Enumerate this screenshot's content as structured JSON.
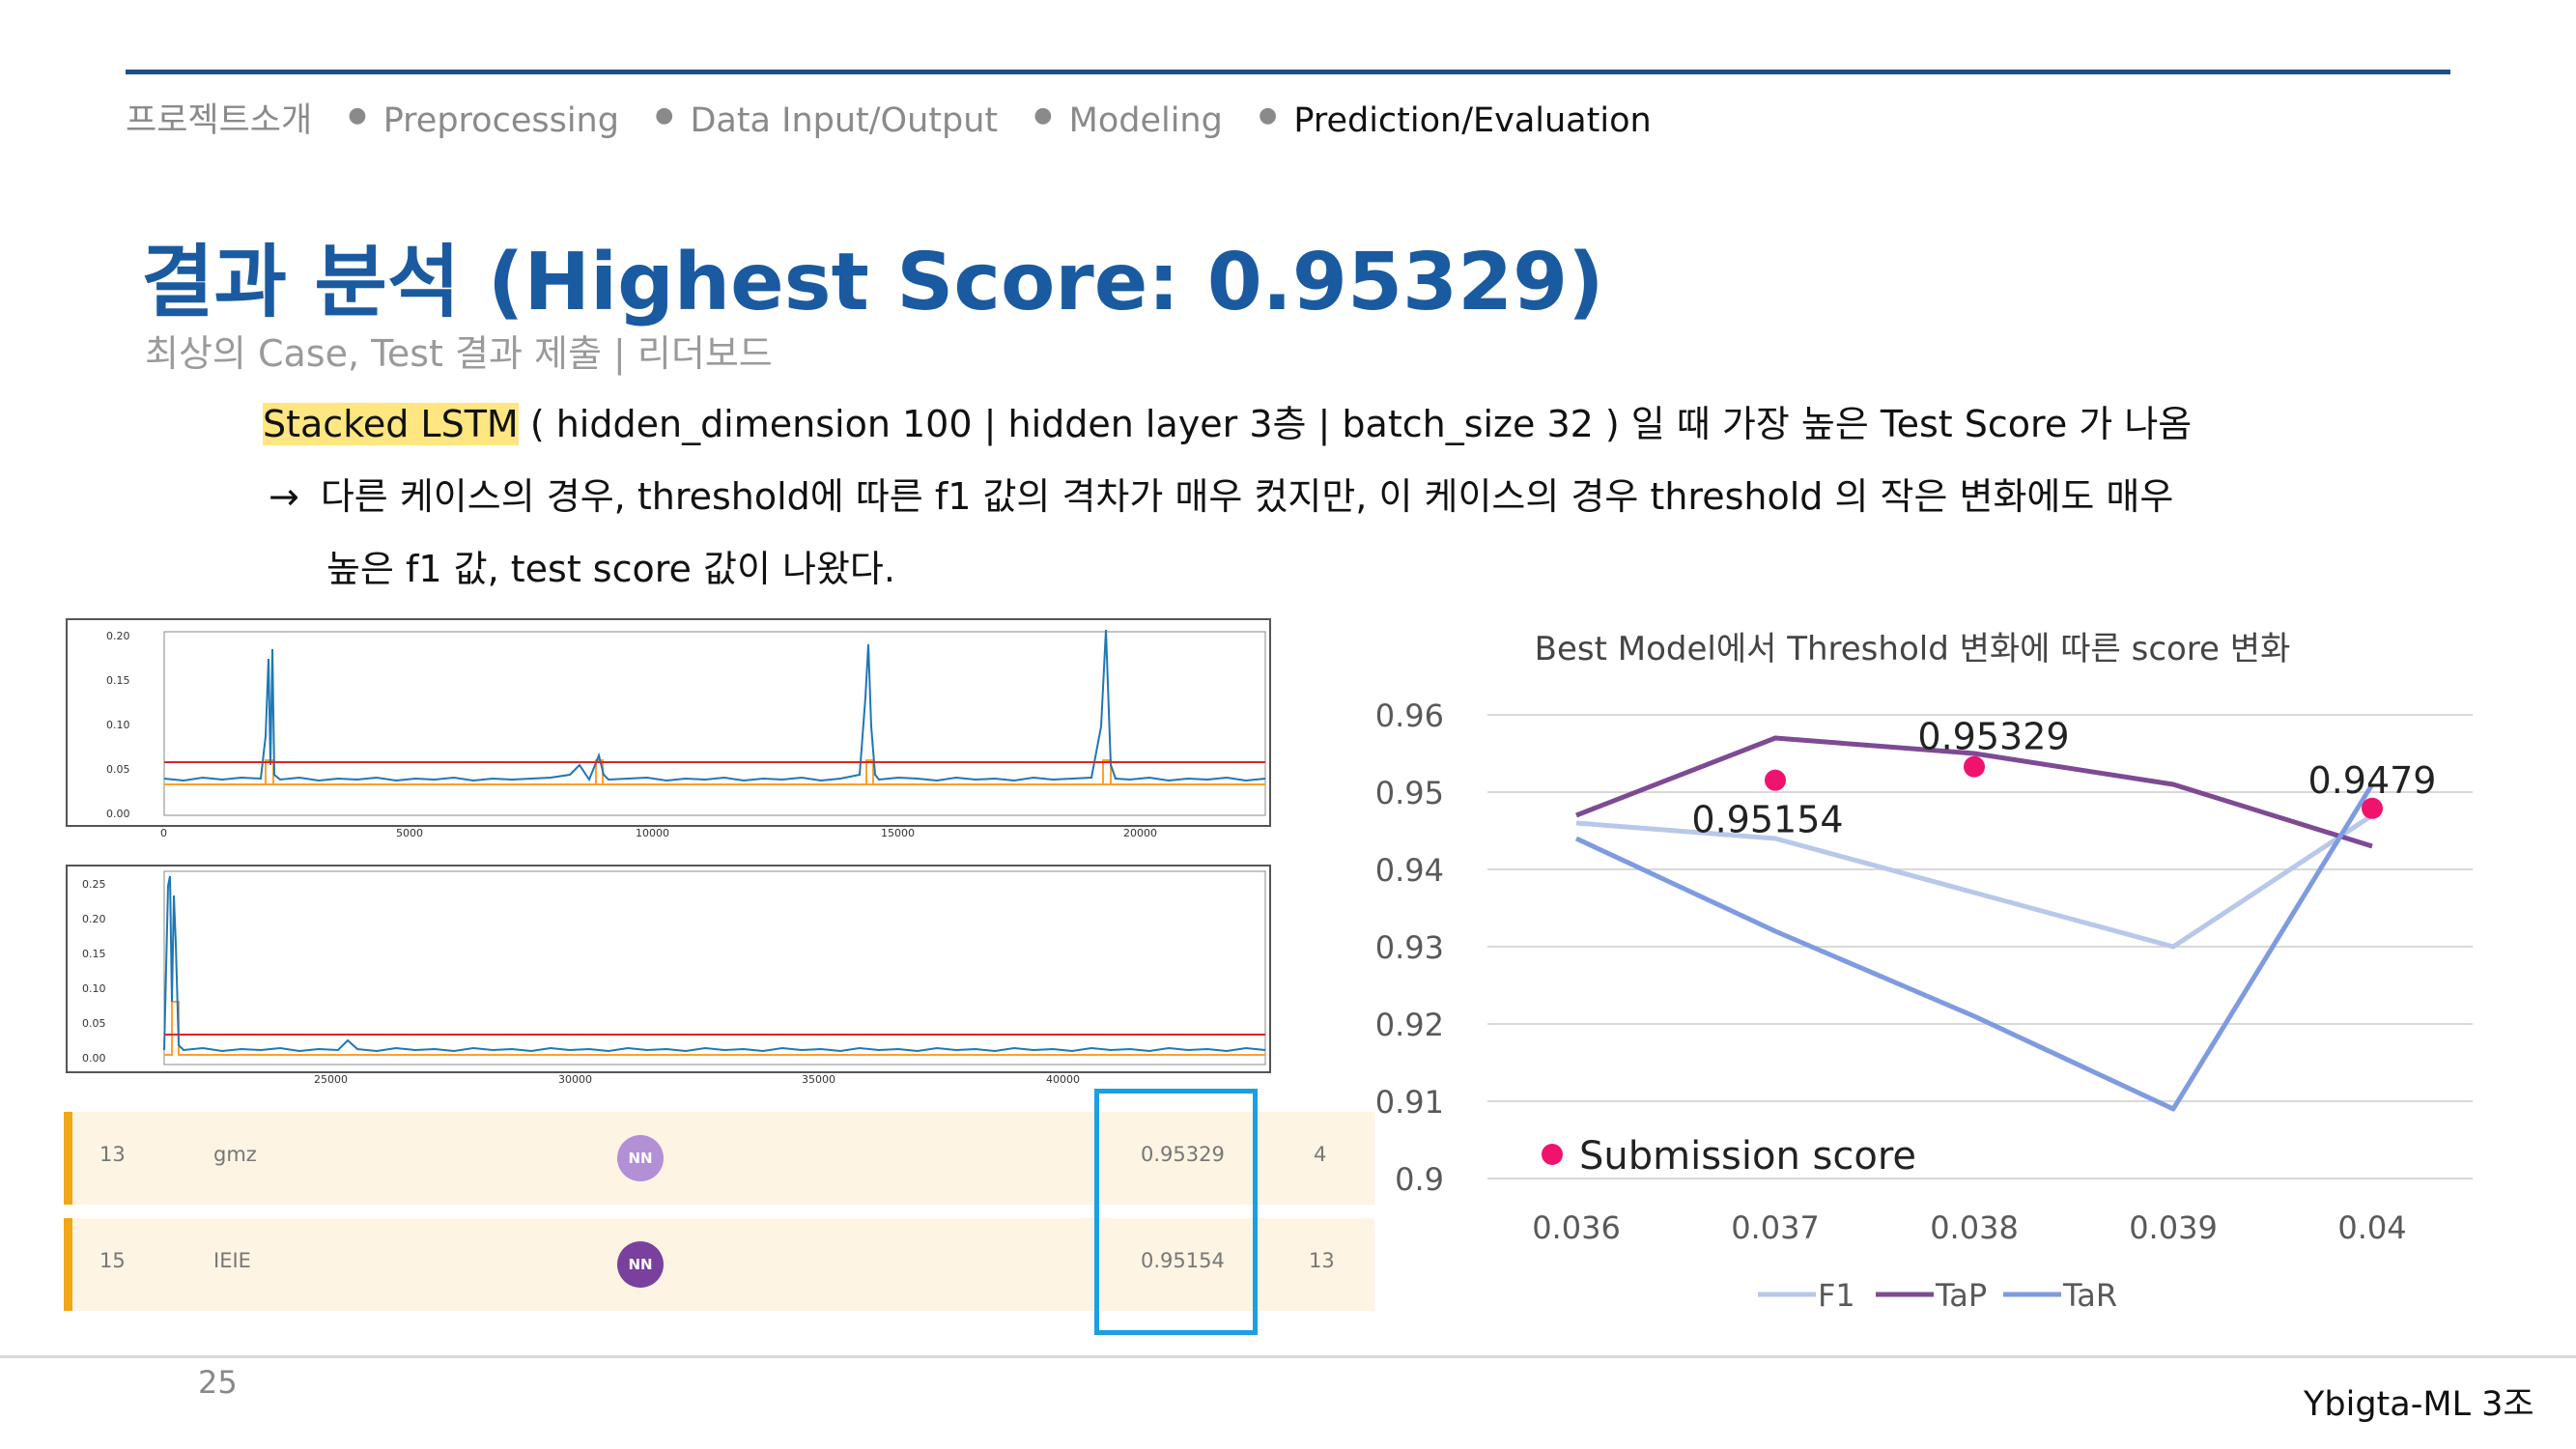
{
  "nav": {
    "items": [
      "프로젝트소개",
      "Preprocessing",
      "Data Input/Output",
      "Modeling",
      "Prediction/Evaluation"
    ],
    "active": "Prediction/Evaluation"
  },
  "title": "결과 분석 (Highest Score: 0.95329)",
  "subtitle": "최상의 Case, Test 결과 제출 | 리더보드",
  "body": {
    "highlight": "Stacked LSTM",
    "line1_rest": " ( hidden_dimension 100 | hidden layer 3층 | batch_size 32 ) 일 때 가장 높은 Test Score 가 나옴",
    "arrow": "→",
    "line2": "다른 케이스의 경우, threshold에 따른 f1 값의 격차가 매우 컸지만, 이 케이스의 경우 threshold 의 작은 변화에도 매우",
    "line3": "높은 f1 값, test score 값이 나왔다."
  },
  "plot1": {
    "yticks": [
      "0.20",
      "0.15",
      "0.10",
      "0.05",
      "0.00"
    ],
    "xticks": [
      "0",
      "5000",
      "10000",
      "15000",
      "20000"
    ],
    "colors": {
      "signal": "#1f77b4",
      "label": "#ff9f2e",
      "threshold": "#d62728"
    }
  },
  "plot2": {
    "yticks": [
      "0.25",
      "0.20",
      "0.15",
      "0.10",
      "0.05",
      "0.00"
    ],
    "xticks": [
      "25000",
      "30000",
      "35000",
      "40000"
    ]
  },
  "leaderboard": [
    {
      "rank": "13",
      "team": "gmz",
      "badge": "NN",
      "badge_color": "#b38fd6",
      "score": "0.95329",
      "entries": "4"
    },
    {
      "rank": "15",
      "team": "IEIE",
      "badge": "NN",
      "badge_color": "#7b3f9e",
      "score": "0.95154",
      "entries": "13"
    }
  ],
  "footer": {
    "page": "25",
    "team": "Ybigta-ML 3조"
  },
  "chart_data": {
    "type": "line",
    "title": "Best Model에서 Threshold 변화에 따른 score 변화",
    "x": [
      0.036,
      0.037,
      0.038,
      0.039,
      0.04
    ],
    "xticks": [
      "0.036",
      "0.037",
      "0.038",
      "0.039",
      "0.04"
    ],
    "ylim": [
      0.9,
      0.96
    ],
    "yticks": [
      "0.96",
      "0.95",
      "0.94",
      "0.93",
      "0.92",
      "0.91",
      "0.9"
    ],
    "grid": true,
    "legend_position": "bottom",
    "series": [
      {
        "name": "F1",
        "color": "#b8c8ea",
        "values": [
          0.946,
          0.944,
          0.937,
          0.93,
          0.947
        ]
      },
      {
        "name": "TaP",
        "color": "#7e4a94",
        "values": [
          0.947,
          0.957,
          0.955,
          0.951,
          0.943
        ]
      },
      {
        "name": "TaR",
        "color": "#7f9be0",
        "values": [
          0.944,
          0.932,
          0.921,
          0.909,
          0.951
        ]
      }
    ],
    "submission": {
      "name": "Submission score",
      "color": "#f0136e",
      "points": [
        {
          "x": 0.037,
          "y": 0.95154,
          "label": "0.95154"
        },
        {
          "x": 0.038,
          "y": 0.95329,
          "label": "0.95329"
        },
        {
          "x": 0.04,
          "y": 0.9479,
          "label": "0.9479"
        }
      ]
    }
  }
}
